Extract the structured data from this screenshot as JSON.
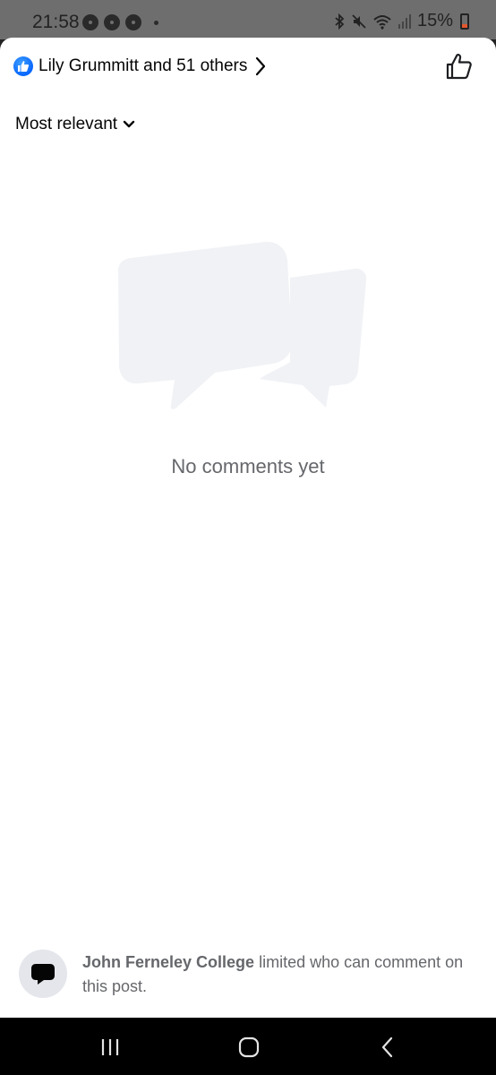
{
  "status_bar": {
    "time": "21:58",
    "battery_percent": "15%",
    "icons": [
      "chrome-icon",
      "chrome-icon",
      "chrome-icon",
      "notification-dot",
      "bluetooth-icon",
      "mute-icon",
      "wifi-icon",
      "signal-icon",
      "battery-icon"
    ]
  },
  "header": {
    "reactions_text": "Lily Grummitt and 51 others",
    "reaction_icon": "like-icon",
    "like_button_icon": "thumbs-up-icon"
  },
  "sort": {
    "label": "Most relevant",
    "icon": "chevron-down-icon"
  },
  "empty_state": {
    "illustration": "chat-bubbles-icon",
    "message": "No comments yet"
  },
  "notice": {
    "page_name": "John Ferneley College",
    "message": "limited who can comment on this post.",
    "icon": "comment-bubble-icon"
  },
  "nav_bar": {
    "icons": [
      "recent-apps-icon",
      "home-icon",
      "back-icon"
    ]
  },
  "colors": {
    "accent": "#0866ff",
    "secondary_text": "#65676b",
    "illustration_fill": "#f0f2f5"
  }
}
